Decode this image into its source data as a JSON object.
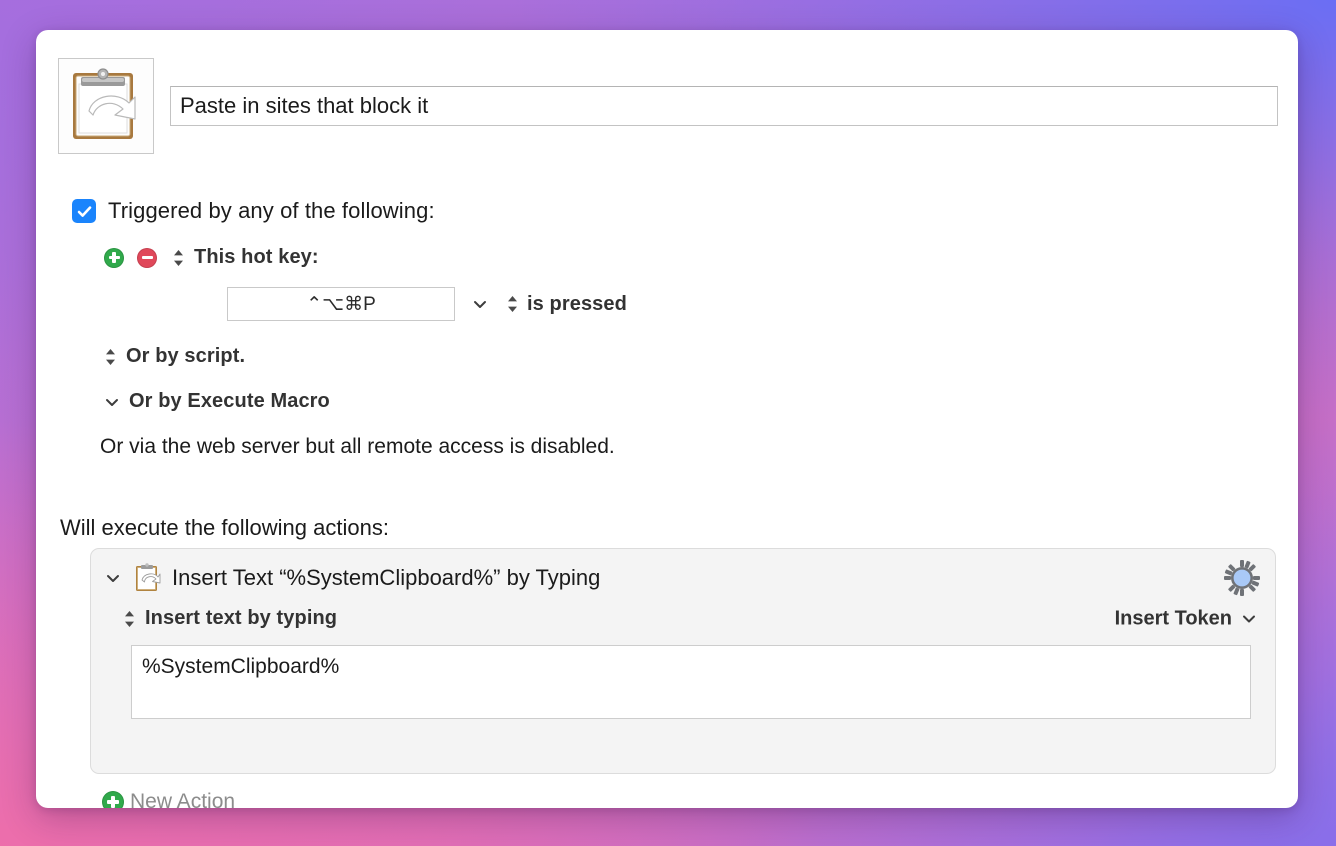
{
  "window": {
    "macro_icon": "clipboard-paste-icon",
    "title_value": "Paste in sites that block it"
  },
  "triggers": {
    "checkbox_checked": true,
    "checkbox_label": "Triggered by any of the following:",
    "add_button": "add-trigger-button",
    "remove_button": "remove-trigger-button",
    "hot_key_label": "This hot key:",
    "hot_key_value": "⌃⌥⌘P",
    "hot_key_condition": "is pressed",
    "script_label": "Or by script.",
    "execute_macro_label": "Or by Execute Macro",
    "web_server_note": "Or via the web server but all remote access is disabled."
  },
  "actions": {
    "heading": "Will execute the following actions:",
    "items": [
      {
        "icon": "clipboard-paste-icon",
        "title": "Insert Text “%SystemClipboard%” by Typing",
        "gear": "gear-icon",
        "mode_label": "Insert text by typing",
        "insert_token_label": "Insert Token",
        "text_value": "%SystemClipboard%"
      }
    ],
    "new_action_label": "New Action"
  },
  "colors": {
    "checkbox_blue": "#1a84fc",
    "add_green": "#30a94b",
    "remove_red": "#e0485a",
    "gear_blue": "#a9c9f7",
    "panel_bg": "#f4f4f4"
  }
}
